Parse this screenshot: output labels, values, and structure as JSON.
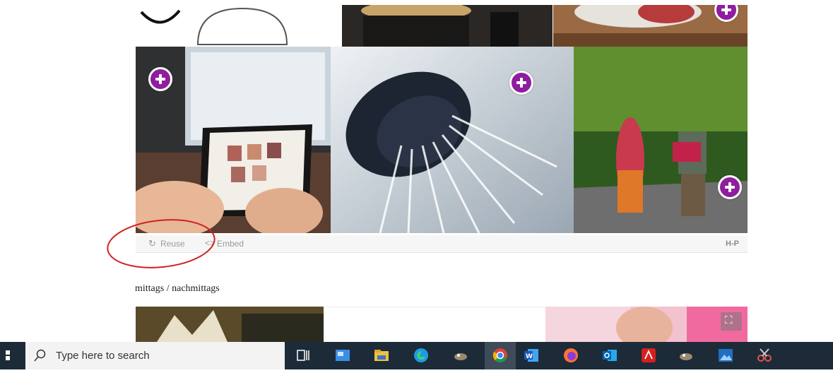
{
  "gallery": {
    "add_label": "Add"
  },
  "h5p_bar": {
    "reuse_label": "Reuse",
    "embed_label": "Embed",
    "logo_text": "H-P"
  },
  "section": {
    "title": "mittags / nachmittags"
  },
  "taskbar": {
    "search_placeholder": "Type here to search",
    "apps": [
      "task-view",
      "news",
      "file-explorer",
      "edge",
      "gimp",
      "chrome",
      "word",
      "firefox",
      "outlook",
      "acrobat",
      "gimp-2",
      "photos",
      "snipping-tool"
    ]
  },
  "colors": {
    "accent": "#8e1e9e",
    "annotation": "#d22020",
    "taskbar": "#1d2b38"
  }
}
